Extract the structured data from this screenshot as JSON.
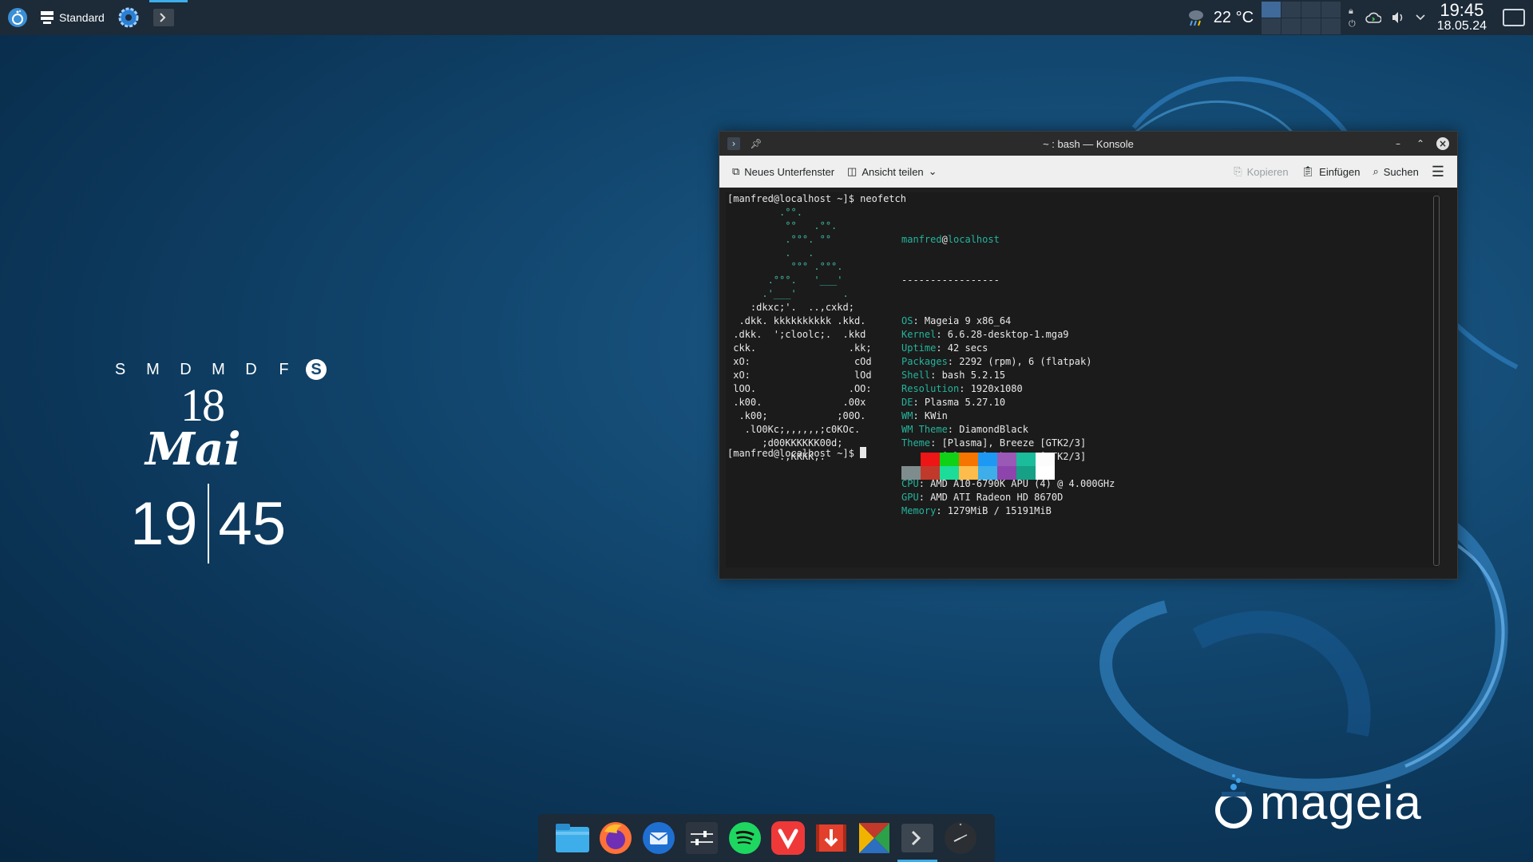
{
  "panel": {
    "activity_label": "Standard",
    "temperature": "22 °C",
    "time": "19:45",
    "date": "18.05.24"
  },
  "calendar": {
    "weekdays": [
      "S",
      "M",
      "D",
      "M",
      "D",
      "F",
      "S"
    ],
    "day": "18",
    "month": "Mai",
    "hour": "19",
    "minute": "45"
  },
  "window": {
    "title": "~ : bash — Konsole",
    "toolbar": {
      "new_tab": "Neues Unterfenster",
      "split_view": "Ansicht teilen",
      "copy": "Kopieren",
      "paste": "Einfügen",
      "search": "Suchen"
    },
    "terminal": {
      "prompt1": "[manfred@localhost ~]$ neofetch",
      "user": "manfred",
      "at": "@",
      "host": "localhost",
      "sep": "-----------------",
      "info": [
        {
          "key": "OS",
          "value": ": Mageia 9 x86_64"
        },
        {
          "key": "Kernel",
          "value": ": 6.6.28-desktop-1.mga9"
        },
        {
          "key": "Uptime",
          "value": ": 42 secs"
        },
        {
          "key": "Packages",
          "value": ": 2292 (rpm), 6 (flatpak)"
        },
        {
          "key": "Shell",
          "value": ": bash 5.2.15"
        },
        {
          "key": "Resolution",
          "value": ": 1920x1080"
        },
        {
          "key": "DE",
          "value": ": Plasma 5.27.10"
        },
        {
          "key": "WM",
          "value": ": KWin"
        },
        {
          "key": "WM Theme",
          "value": ": DiamondBlack"
        },
        {
          "key": "Theme",
          "value": ": [Plasma], Breeze [GTK2/3]"
        },
        {
          "key": "Icons",
          "value": ": [Plasma], breeze [GTK2/3]"
        },
        {
          "key": "Terminal",
          "value": ": konsole"
        },
        {
          "key": "CPU",
          "value": ": AMD A10-6790K APU (4) @ 4.000GHz"
        },
        {
          "key": "GPU",
          "value": ": AMD ATI Radeon HD 8670D"
        },
        {
          "key": "Memory",
          "value": ": 1279MiB / 15191MiB"
        }
      ],
      "ascii": [
        "         .°°.",
        "          °°   .°°.",
        "          .°°°. °°",
        "          .   .",
        "           °°° .°°°.",
        "       .°°°.   '___'",
        "      .'___'        .",
        "    :dkxc;'.  ..,cxkd;",
        "  .dkk. kkkkkkkkkk .kkd.",
        " .dkk.  ';cloolc;.  .kkd",
        " ckk.                .kk;",
        " xO:                  cOd",
        " xO:                  lOd",
        " lOO.                .OO:",
        " .k00.              .00x",
        "  .k00;            ;00O.",
        "   .lO0Kc;,,,,,,;c0KOc.",
        "      ;d00KKKKKK00d;",
        "         .,KKKK,."
      ],
      "swatches_top": [
        "#1b1b1b",
        "#ed1515",
        "#11d116",
        "#f67400",
        "#1d99f3",
        "#9b59b6",
        "#1abc9c",
        "#fcfcfc"
      ],
      "swatches_bottom": [
        "#7f8c8d",
        "#c0392b",
        "#1cdc9a",
        "#fdbc4b",
        "#3daee9",
        "#8e44ad",
        "#16a085",
        "#ffffff"
      ],
      "prompt2": "[manfred@localhost ~]$ "
    }
  },
  "dock": {
    "icons": [
      "folder-icon",
      "firefox-icon",
      "thunderbird-icon",
      "settings-sliders-icon",
      "spotify-icon",
      "vivaldi-icon",
      "video-downloader-icon",
      "kleopatra-icon",
      "konsole-icon",
      "clock-icon"
    ]
  },
  "logo": {
    "text": "mageia"
  }
}
